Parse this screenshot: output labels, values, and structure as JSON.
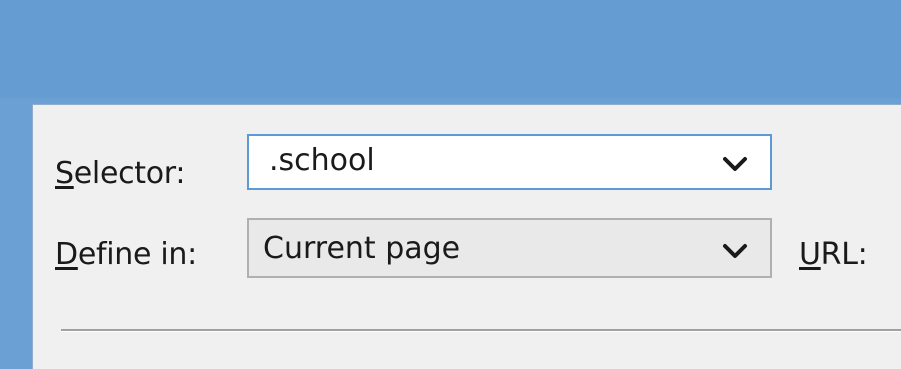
{
  "form": {
    "selector": {
      "label_accel": "S",
      "label_rest": "elector:",
      "value": ".school"
    },
    "define_in": {
      "label_accel": "D",
      "label_rest": "efine in:",
      "value": "Current page"
    },
    "url": {
      "label_accel": "U",
      "label_rest": "RL:"
    }
  },
  "icons": {
    "dropdown": "chevron-down-icon"
  },
  "colors": {
    "titlebar": "#659cd1",
    "dialog_bg": "#f0f0f0",
    "focus_border": "#5d9ad4"
  }
}
